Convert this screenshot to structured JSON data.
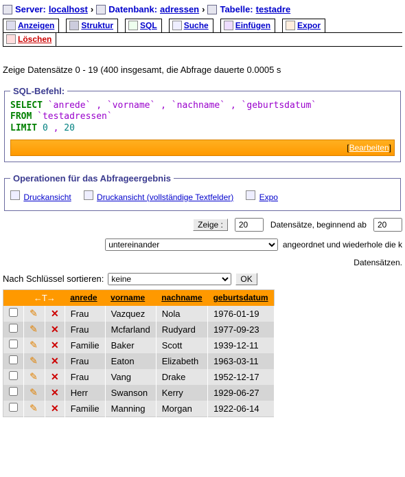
{
  "breadcrumb": {
    "server_label": "Server:",
    "server_value": "localhost",
    "db_label": "Datenbank:",
    "db_value": "adressen",
    "table_label": "Tabelle:",
    "table_value": "testadre"
  },
  "tabs": {
    "browse": "Anzeigen",
    "structure": "Struktur",
    "sql": "SQL",
    "search": "Suche",
    "insert": "Einfügen",
    "export": "Expor",
    "delete": "Löschen"
  },
  "status": "Zeige Datensätze 0 - 19 (400 insgesamt, die Abfrage dauerte 0.0005 s",
  "sql_legend": "SQL-Befehl:",
  "sql": {
    "kw_select": "SELECT",
    "cols": " `anrede` , `vorname` , `nachname` , `geburtsdatum` ",
    "kw_from": "FROM",
    "from_val": " `testadressen` ",
    "kw_limit": "LIMIT",
    "lim_a": "0",
    "lim_sep": " , ",
    "lim_b": "20"
  },
  "sql_edit_bracket_l": "[ ",
  "sql_edit": "Bearbeiten",
  "sql_edit_bracket_r": " ]",
  "ops_legend": "Operationen für das Abfrageergebnis",
  "ops": {
    "print": "Druckansicht",
    "print_full": "Druckansicht (vollständige Textfelder)",
    "export": "Expo"
  },
  "nav": {
    "show_btn": "Zeige :",
    "rows": "20",
    "text_rows": "Datensätze, beginnend ab",
    "start": "20",
    "mode": "untereinander",
    "text_repeat": "angeordnet und wiederhole die k",
    "text_rows2": "Datensätzen."
  },
  "sort": {
    "label": "Nach Schlüssel sortieren:",
    "value": "keine",
    "ok": "OK"
  },
  "table": {
    "arrow_label": "←T→",
    "headers": {
      "anrede": "anrede",
      "vorname": "vorname",
      "nachname": "nachname",
      "geburtsdatum": "geburtsdatum"
    },
    "rows": [
      {
        "anrede": "Frau",
        "vorname": "Vazquez",
        "nachname": "Nola",
        "geburtsdatum": "1976-01-19"
      },
      {
        "anrede": "Frau",
        "vorname": "Mcfarland",
        "nachname": "Rudyard",
        "geburtsdatum": "1977-09-23"
      },
      {
        "anrede": "Familie",
        "vorname": "Baker",
        "nachname": "Scott",
        "geburtsdatum": "1939-12-11"
      },
      {
        "anrede": "Frau",
        "vorname": "Eaton",
        "nachname": "Elizabeth",
        "geburtsdatum": "1963-03-11"
      },
      {
        "anrede": "Frau",
        "vorname": "Vang",
        "nachname": "Drake",
        "geburtsdatum": "1952-12-17"
      },
      {
        "anrede": "Herr",
        "vorname": "Swanson",
        "nachname": "Kerry",
        "geburtsdatum": "1929-06-27"
      },
      {
        "anrede": "Familie",
        "vorname": "Manning",
        "nachname": "Morgan",
        "geburtsdatum": "1922-06-14"
      }
    ]
  }
}
